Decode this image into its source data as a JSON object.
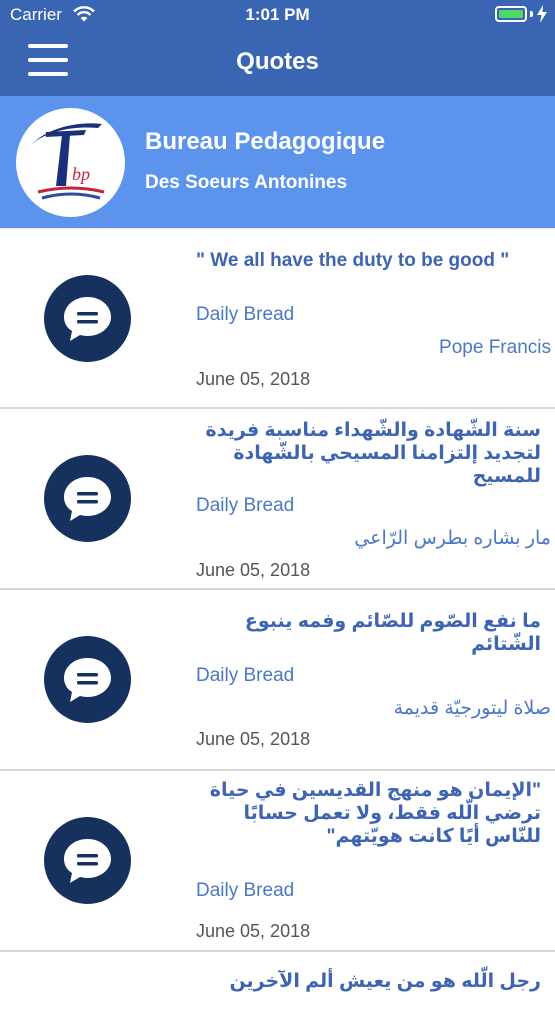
{
  "status_bar": {
    "carrier": "Carrier",
    "time": "1:01 PM",
    "battery_level": 1.0
  },
  "nav": {
    "title": "Quotes"
  },
  "banner": {
    "org_name": "Bureau Pedagogique",
    "org_subtitle": "Des Soeurs Antonines",
    "logo_text": "T bp"
  },
  "quotes": [
    {
      "text": "\" We all have the duty to be good \"",
      "rtl": false,
      "category": "Daily Bread",
      "author": "Pope Francis",
      "date": "June 05, 2018"
    },
    {
      "text": "سنة الشّهادة والشّهداء مناسبة فريدة لتجديد إلتزامنا المسيحي بالشّهادة للمسيح",
      "rtl": true,
      "category": "Daily Bread",
      "author": "مار بشاره بطرس الرّاعي",
      "date": "June 05, 2018"
    },
    {
      "text": "ما نفع الصّوم للصّائم وفمه ينبوع الشّتائم",
      "rtl": true,
      "category": "Daily Bread",
      "author": "صلاة ليتورجيّة قديمة",
      "date": "June 05, 2018"
    },
    {
      "text": "\"الإيمان هو منهج القديسين في حياة ترضي الّله فقط، ولا تعمل حسابًا للنّاس أيًا كانت هويّتهم\"",
      "rtl": true,
      "category": "Daily Bread",
      "author": "",
      "date": "June 05, 2018"
    },
    {
      "text": "رجل الّله هو من يعيش ألم الآخرين",
      "rtl": true,
      "category": "",
      "author": "",
      "date": ""
    }
  ],
  "colors": {
    "nav": "#3a65b3",
    "banner": "#5b93ed",
    "bubble": "#17315f",
    "accent": "#3e64b2"
  }
}
